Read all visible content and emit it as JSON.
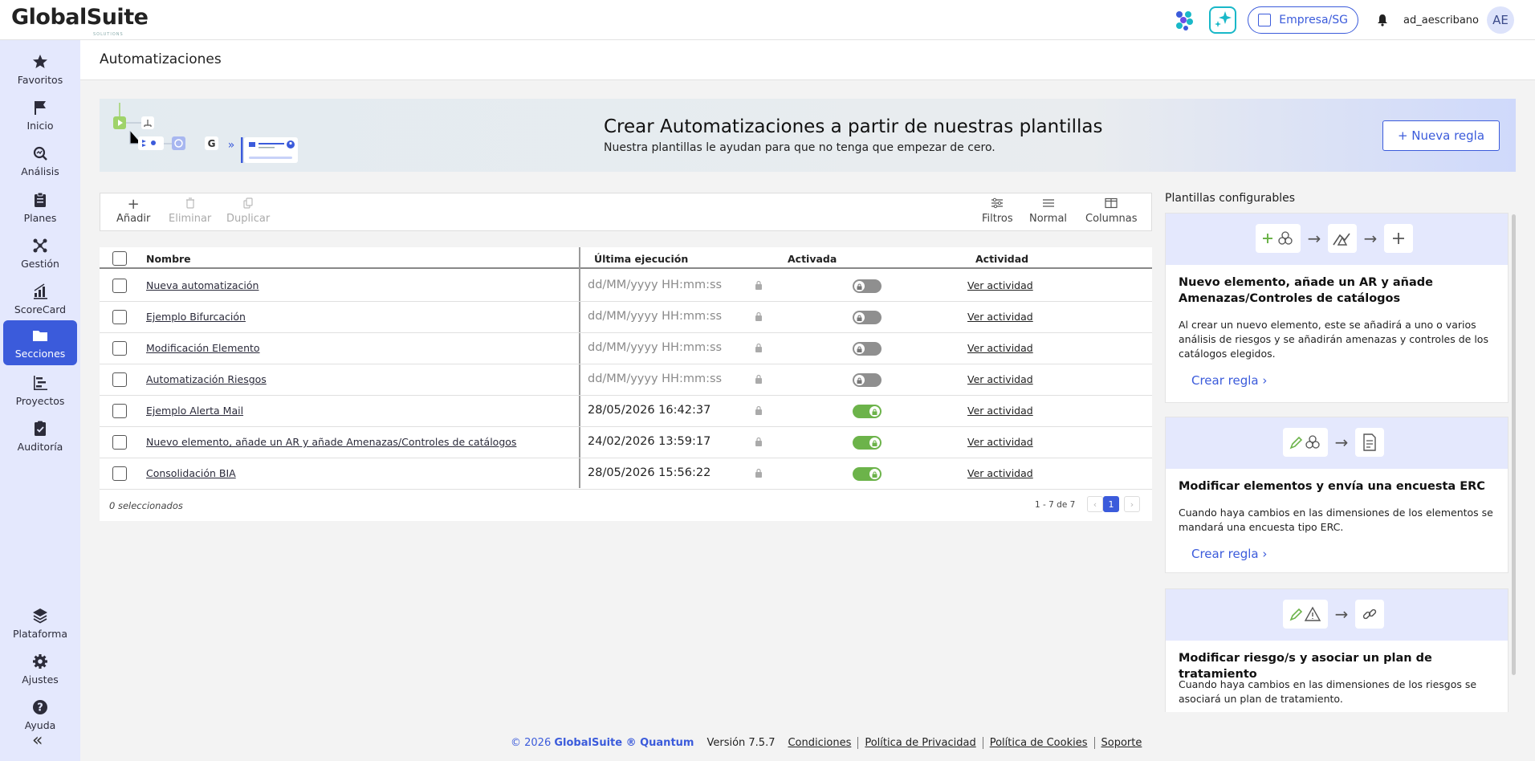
{
  "app": {
    "brand": "GlobalSuite",
    "brand_sub": "SOLUTIONS",
    "company": "Empresa/SG",
    "username": "ad_aescribano",
    "avatar_initials": "AE",
    "accent_color": "#3b5bdb"
  },
  "sidebar": {
    "items": [
      {
        "label": "Favoritos",
        "icon": "star-icon"
      },
      {
        "label": "Inicio",
        "icon": "flag-icon"
      },
      {
        "label": "Análisis",
        "icon": "analysis-search-icon"
      },
      {
        "label": "Planes",
        "icon": "clipboard-icon"
      },
      {
        "label": "Gestión",
        "icon": "network-icon"
      },
      {
        "label": "ScoreCard",
        "icon": "bar-chart-icon"
      },
      {
        "label": "Secciones",
        "icon": "folder-icon",
        "active": true
      },
      {
        "label": "Proyectos",
        "icon": "gantt-icon"
      },
      {
        "label": "Auditoría",
        "icon": "checklist-icon"
      }
    ],
    "bottom_items": [
      {
        "label": "Plataforma",
        "icon": "layers-icon"
      },
      {
        "label": "Ajustes",
        "icon": "gear-icon"
      },
      {
        "label": "Ayuda",
        "icon": "help-icon"
      }
    ],
    "collapse": "«"
  },
  "page": {
    "title": "Automatizaciones"
  },
  "banner": {
    "title": "Crear Automatizaciones a partir de nuestras plantillas",
    "subtitle": "Nuestra plantillas le ayudan para que no tenga que empezar de cero.",
    "button": "+ Nueva regla"
  },
  "toolbar": {
    "add": "Añadir",
    "delete": "Eliminar",
    "duplicate": "Duplicar",
    "filters": "Filtros",
    "density": "Normal",
    "columns": "Columnas"
  },
  "table": {
    "headers": {
      "name": "Nombre",
      "last_run": "Última ejecución",
      "enabled": "Activada",
      "activity": "Actividad"
    },
    "rows": [
      {
        "name": "Nueva automatización",
        "last_run": "dd/MM/yyyy HH:mm:ss",
        "placeholder": true,
        "enabled": false,
        "activity": "Ver actividad"
      },
      {
        "name": "Ejemplo Bifurcación",
        "last_run": "dd/MM/yyyy HH:mm:ss",
        "placeholder": true,
        "enabled": false,
        "activity": "Ver actividad"
      },
      {
        "name": "Modificación Elemento",
        "last_run": "dd/MM/yyyy HH:mm:ss",
        "placeholder": true,
        "enabled": false,
        "activity": "Ver actividad"
      },
      {
        "name": "Automatización Riesgos",
        "last_run": "dd/MM/yyyy HH:mm:ss",
        "placeholder": true,
        "enabled": false,
        "activity": "Ver actividad"
      },
      {
        "name": "Ejemplo Alerta Mail",
        "last_run": "28/05/2026 16:42:37",
        "placeholder": false,
        "enabled": true,
        "activity": "Ver actividad"
      },
      {
        "name": "Nuevo elemento, añade un AR y añade Amenazas/Controles de catálogos",
        "last_run": "24/02/2026 13:59:17",
        "placeholder": false,
        "enabled": true,
        "activity": "Ver actividad"
      },
      {
        "name": "Consolidación BIA",
        "last_run": "28/05/2026 15:56:22",
        "placeholder": false,
        "enabled": true,
        "activity": "Ver actividad"
      }
    ],
    "selected_count": "0 seleccionados",
    "range": "1 - 7 de 7",
    "current_page": "1",
    "prev": "‹",
    "next": "›"
  },
  "templates": {
    "title": "Plantillas configurables",
    "cards": [
      {
        "title": "Nuevo elemento, añade un AR y añade Amenazas/Controles de catálogos",
        "description": "Al crear un nuevo elemento, este se añadirá a uno o varios análisis de riesgos y se añadirán amenazas y controles de los catálogos elegidos.",
        "link": "Crear regla ›"
      },
      {
        "title": "Modificar elementos y envía una encuesta ERC",
        "description": "Cuando haya cambios en las dimensiones de los elementos se mandará una encuesta tipo ERC.",
        "link": "Crear regla ›"
      },
      {
        "title": "Modificar riesgo/s y asociar un plan de tratamiento",
        "description": "Cuando haya cambios en las dimensiones de los riesgos se asociará un plan de tratamiento.",
        "link": ""
      }
    ]
  },
  "footer": {
    "copyright": "© 2026",
    "product": "GlobalSuite ® Quantum",
    "version": "Versión 7.5.7",
    "links": [
      "Condiciones",
      "Política de Privacidad",
      "Política de Cookies",
      "Soporte"
    ]
  }
}
